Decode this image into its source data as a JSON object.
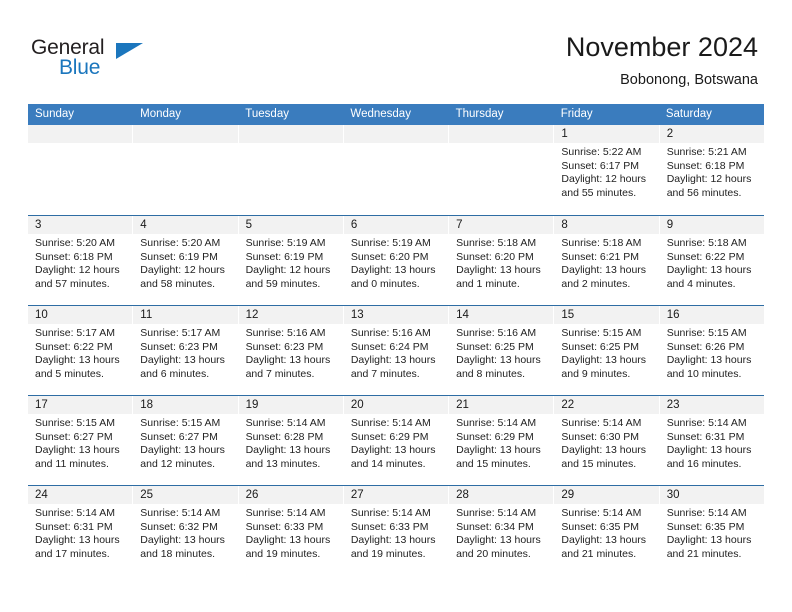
{
  "brand": {
    "name_part1": "General",
    "name_part2": "Blue",
    "flag_icon": "triangle-flag-icon"
  },
  "header": {
    "title": "November 2024",
    "subtitle": "Bobonong, Botswana"
  },
  "colors": {
    "header_blue": "#3A7CBE",
    "header_blue_border": "#2E6DA4",
    "brand_blue": "#1B76BD",
    "day_band_gray": "#F2F2F2",
    "text": "#1A1A1A"
  },
  "weekdays": [
    "Sunday",
    "Monday",
    "Tuesday",
    "Wednesday",
    "Thursday",
    "Friday",
    "Saturday"
  ],
  "weeks": [
    [
      {
        "day": "",
        "empty": true,
        "lines": []
      },
      {
        "day": "",
        "empty": true,
        "lines": []
      },
      {
        "day": "",
        "empty": true,
        "lines": []
      },
      {
        "day": "",
        "empty": true,
        "lines": []
      },
      {
        "day": "",
        "empty": true,
        "lines": []
      },
      {
        "day": "1",
        "empty": false,
        "lines": [
          "Sunrise: 5:22 AM",
          "Sunset: 6:17 PM",
          "Daylight: 12 hours",
          "and 55 minutes."
        ]
      },
      {
        "day": "2",
        "empty": false,
        "lines": [
          "Sunrise: 5:21 AM",
          "Sunset: 6:18 PM",
          "Daylight: 12 hours",
          "and 56 minutes."
        ]
      }
    ],
    [
      {
        "day": "3",
        "empty": false,
        "lines": [
          "Sunrise: 5:20 AM",
          "Sunset: 6:18 PM",
          "Daylight: 12 hours",
          "and 57 minutes."
        ]
      },
      {
        "day": "4",
        "empty": false,
        "lines": [
          "Sunrise: 5:20 AM",
          "Sunset: 6:19 PM",
          "Daylight: 12 hours",
          "and 58 minutes."
        ]
      },
      {
        "day": "5",
        "empty": false,
        "lines": [
          "Sunrise: 5:19 AM",
          "Sunset: 6:19 PM",
          "Daylight: 12 hours",
          "and 59 minutes."
        ]
      },
      {
        "day": "6",
        "empty": false,
        "lines": [
          "Sunrise: 5:19 AM",
          "Sunset: 6:20 PM",
          "Daylight: 13 hours",
          "and 0 minutes."
        ]
      },
      {
        "day": "7",
        "empty": false,
        "lines": [
          "Sunrise: 5:18 AM",
          "Sunset: 6:20 PM",
          "Daylight: 13 hours",
          "and 1 minute."
        ]
      },
      {
        "day": "8",
        "empty": false,
        "lines": [
          "Sunrise: 5:18 AM",
          "Sunset: 6:21 PM",
          "Daylight: 13 hours",
          "and 2 minutes."
        ]
      },
      {
        "day": "9",
        "empty": false,
        "lines": [
          "Sunrise: 5:18 AM",
          "Sunset: 6:22 PM",
          "Daylight: 13 hours",
          "and 4 minutes."
        ]
      }
    ],
    [
      {
        "day": "10",
        "empty": false,
        "lines": [
          "Sunrise: 5:17 AM",
          "Sunset: 6:22 PM",
          "Daylight: 13 hours",
          "and 5 minutes."
        ]
      },
      {
        "day": "11",
        "empty": false,
        "lines": [
          "Sunrise: 5:17 AM",
          "Sunset: 6:23 PM",
          "Daylight: 13 hours",
          "and 6 minutes."
        ]
      },
      {
        "day": "12",
        "empty": false,
        "lines": [
          "Sunrise: 5:16 AM",
          "Sunset: 6:23 PM",
          "Daylight: 13 hours",
          "and 7 minutes."
        ]
      },
      {
        "day": "13",
        "empty": false,
        "lines": [
          "Sunrise: 5:16 AM",
          "Sunset: 6:24 PM",
          "Daylight: 13 hours",
          "and 7 minutes."
        ]
      },
      {
        "day": "14",
        "empty": false,
        "lines": [
          "Sunrise: 5:16 AM",
          "Sunset: 6:25 PM",
          "Daylight: 13 hours",
          "and 8 minutes."
        ]
      },
      {
        "day": "15",
        "empty": false,
        "lines": [
          "Sunrise: 5:15 AM",
          "Sunset: 6:25 PM",
          "Daylight: 13 hours",
          "and 9 minutes."
        ]
      },
      {
        "day": "16",
        "empty": false,
        "lines": [
          "Sunrise: 5:15 AM",
          "Sunset: 6:26 PM",
          "Daylight: 13 hours",
          "and 10 minutes."
        ]
      }
    ],
    [
      {
        "day": "17",
        "empty": false,
        "lines": [
          "Sunrise: 5:15 AM",
          "Sunset: 6:27 PM",
          "Daylight: 13 hours",
          "and 11 minutes."
        ]
      },
      {
        "day": "18",
        "empty": false,
        "lines": [
          "Sunrise: 5:15 AM",
          "Sunset: 6:27 PM",
          "Daylight: 13 hours",
          "and 12 minutes."
        ]
      },
      {
        "day": "19",
        "empty": false,
        "lines": [
          "Sunrise: 5:14 AM",
          "Sunset: 6:28 PM",
          "Daylight: 13 hours",
          "and 13 minutes."
        ]
      },
      {
        "day": "20",
        "empty": false,
        "lines": [
          "Sunrise: 5:14 AM",
          "Sunset: 6:29 PM",
          "Daylight: 13 hours",
          "and 14 minutes."
        ]
      },
      {
        "day": "21",
        "empty": false,
        "lines": [
          "Sunrise: 5:14 AM",
          "Sunset: 6:29 PM",
          "Daylight: 13 hours",
          "and 15 minutes."
        ]
      },
      {
        "day": "22",
        "empty": false,
        "lines": [
          "Sunrise: 5:14 AM",
          "Sunset: 6:30 PM",
          "Daylight: 13 hours",
          "and 15 minutes."
        ]
      },
      {
        "day": "23",
        "empty": false,
        "lines": [
          "Sunrise: 5:14 AM",
          "Sunset: 6:31 PM",
          "Daylight: 13 hours",
          "and 16 minutes."
        ]
      }
    ],
    [
      {
        "day": "24",
        "empty": false,
        "lines": [
          "Sunrise: 5:14 AM",
          "Sunset: 6:31 PM",
          "Daylight: 13 hours",
          "and 17 minutes."
        ]
      },
      {
        "day": "25",
        "empty": false,
        "lines": [
          "Sunrise: 5:14 AM",
          "Sunset: 6:32 PM",
          "Daylight: 13 hours",
          "and 18 minutes."
        ]
      },
      {
        "day": "26",
        "empty": false,
        "lines": [
          "Sunrise: 5:14 AM",
          "Sunset: 6:33 PM",
          "Daylight: 13 hours",
          "and 19 minutes."
        ]
      },
      {
        "day": "27",
        "empty": false,
        "lines": [
          "Sunrise: 5:14 AM",
          "Sunset: 6:33 PM",
          "Daylight: 13 hours",
          "and 19 minutes."
        ]
      },
      {
        "day": "28",
        "empty": false,
        "lines": [
          "Sunrise: 5:14 AM",
          "Sunset: 6:34 PM",
          "Daylight: 13 hours",
          "and 20 minutes."
        ]
      },
      {
        "day": "29",
        "empty": false,
        "lines": [
          "Sunrise: 5:14 AM",
          "Sunset: 6:35 PM",
          "Daylight: 13 hours",
          "and 21 minutes."
        ]
      },
      {
        "day": "30",
        "empty": false,
        "lines": [
          "Sunrise: 5:14 AM",
          "Sunset: 6:35 PM",
          "Daylight: 13 hours",
          "and 21 minutes."
        ]
      }
    ]
  ]
}
